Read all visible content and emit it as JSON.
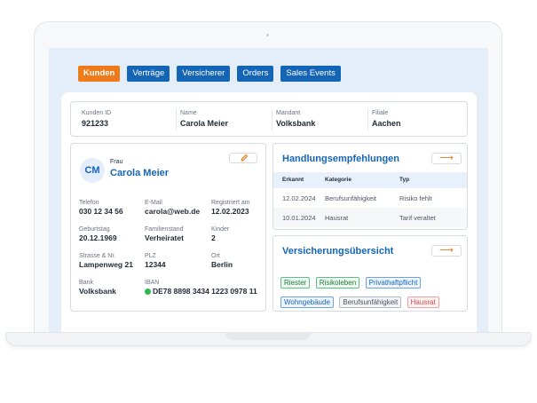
{
  "nav": {
    "items": [
      {
        "label": "Kunden",
        "active": true
      },
      {
        "label": "Verträge",
        "active": false
      },
      {
        "label": "Versicherer",
        "active": false
      },
      {
        "label": "Orders",
        "active": false
      },
      {
        "label": "Sales Events",
        "active": false
      }
    ]
  },
  "header": {
    "kunden_id_label": "Kunden ID",
    "kunden_id": "921233",
    "name_label": "Name",
    "name": "Carola Meier",
    "mandant_label": "Mandant",
    "mandant": "Volksbank",
    "filiale_label": "Filiale",
    "filiale": "Aachen"
  },
  "customer": {
    "initials": "CM",
    "salutation": "Frau",
    "name": "Carola Meier",
    "edit_icon": "pencil-icon",
    "fields": {
      "telefon_label": "Telefon",
      "telefon": "030 12 34 56",
      "email_label": "E-Mail",
      "email": "carola@web.de",
      "registriert_label": "Registriert am",
      "registriert": "12.02.2023",
      "geburtstag_label": "Geburtstag",
      "geburtstag": "20.12.1969",
      "familienstand_label": "Familienstand",
      "familienstand": "Verheiratet",
      "kinder_label": "Kinder",
      "kinder": "2",
      "strasse_label": "Strasse & Nr.",
      "strasse": "Lampenweg 21",
      "plz_label": "PLZ",
      "plz": "12344",
      "ort_label": "Ort",
      "ort": "Berlin",
      "bank_label": "Bank",
      "bank": "Volksbank",
      "iban_label": "IBAN",
      "iban": "DE78 8898 3434 1223 0978 11"
    }
  },
  "recommendations": {
    "title": "Handlungsempfehlungen",
    "arrow_icon": "arrow-right-icon",
    "columns": [
      "Erkannt",
      "Kategorie",
      "Typ"
    ],
    "rows": [
      {
        "erkannt": "12.02.2024",
        "kategorie": "Berufsunfähigkeit",
        "typ": "Risiko fehlt"
      },
      {
        "erkannt": "10.01.2024",
        "kategorie": "Hausrat",
        "typ": "Tarif veraltet"
      }
    ]
  },
  "overview": {
    "title": "Versicherungsübersicht",
    "arrow_icon": "arrow-right-icon",
    "tags": [
      {
        "label": "Riester",
        "status": "green"
      },
      {
        "label": "Risikoleben",
        "status": "green"
      },
      {
        "label": "Privathaftpflicht",
        "status": "blue"
      },
      {
        "label": "Wohngebäude",
        "status": "blue"
      },
      {
        "label": "Berufsunfähigkeit",
        "status": "gray"
      },
      {
        "label": "Hausrat",
        "status": "red"
      }
    ]
  },
  "colors": {
    "primary": "#1565b7",
    "accent": "#ef7a1a",
    "screen_bg": "#e4eef9",
    "ok": "#2fb84f"
  }
}
